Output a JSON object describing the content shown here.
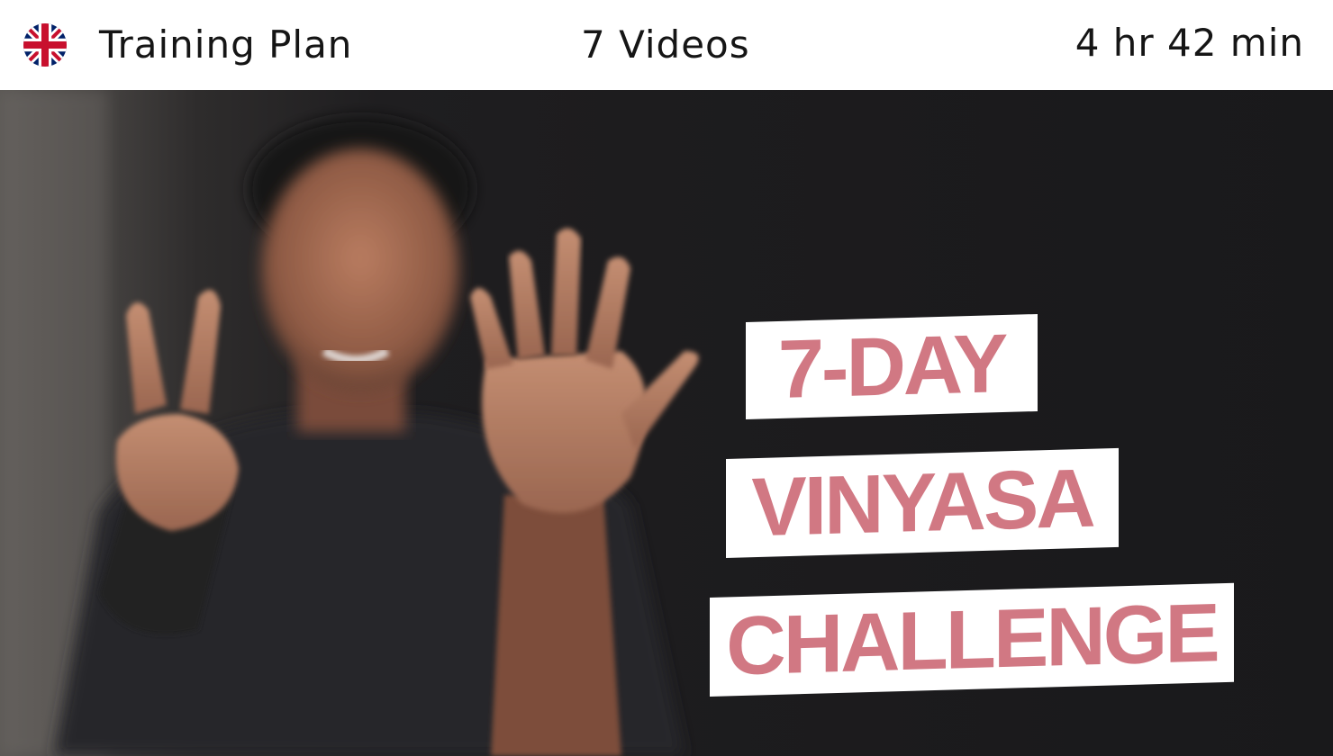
{
  "header": {
    "flag_icon": "uk-flag-icon",
    "title": "Training Plan",
    "video_count": "7 Videos",
    "duration": "4 hr 42 min"
  },
  "hero": {
    "title_lines": [
      "7-DAY",
      "VINYASA",
      "CHALLENGE"
    ],
    "title_color": "#d17883",
    "title_background": "#ffffff"
  }
}
